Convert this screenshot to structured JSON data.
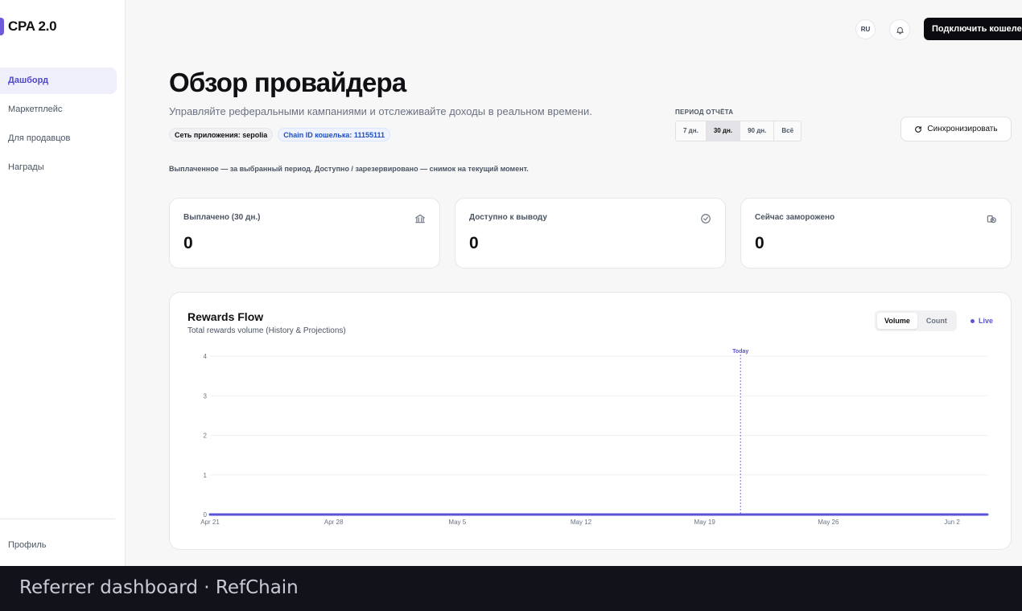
{
  "app": {
    "logo": "CPA 2.0"
  },
  "sidebar": {
    "items": [
      {
        "label": "Дашборд",
        "active": true
      },
      {
        "label": "Маркетплейс",
        "active": false
      },
      {
        "label": "Для продавцов",
        "active": false
      },
      {
        "label": "Награды",
        "active": false
      }
    ],
    "profile": "Профиль"
  },
  "topbar": {
    "lang": "RU",
    "bell_icon": "bell-icon",
    "connect": "Подключить кошелек"
  },
  "header": {
    "title": "Обзор провайдера",
    "subtitle": "Управляйте реферальными кампаниями и отслеживайте доходы в реальном времени.",
    "chips": [
      "Сеть приложения: sepolia",
      "Chain ID кошелька: 11155111"
    ],
    "note": "Выплаченное — за выбранный период. Доступно / зарезервировано — снимок на текущий момент."
  },
  "period": {
    "label": "ПЕРИОД ОТЧЁТА",
    "options": [
      "7 дн.",
      "30 дн.",
      "90 дн.",
      "Всё"
    ],
    "selected": "30 дн."
  },
  "sync": {
    "label": "Синхронизировать",
    "icon": "refresh-icon"
  },
  "stats": [
    {
      "label": "Выплачено (30 дн.)",
      "value": "0",
      "icon": "bank-icon"
    },
    {
      "label": "Доступно к выводу",
      "value": "0",
      "icon": "check-circle-icon"
    },
    {
      "label": "Сейчас заморожено",
      "value": "0",
      "icon": "frozen-coins-icon"
    }
  ],
  "chart": {
    "title": "Rewards Flow",
    "subtitle": "Total rewards volume (History & Projections)",
    "toggle": [
      "Volume",
      "Count"
    ],
    "toggle_selected": "Volume",
    "live": "Live",
    "today_label": "Today",
    "accent": "#5b52d6"
  },
  "chart_data": {
    "type": "line",
    "x": [
      "Apr 21",
      "Apr 28",
      "May 5",
      "May 12",
      "May 19",
      "May 26",
      "Jun 2"
    ],
    "series": [
      {
        "values": [
          0,
          0,
          0,
          0,
          0,
          0,
          0
        ]
      }
    ],
    "yticks": [
      0,
      1,
      2,
      3,
      4
    ],
    "ylim": [
      0,
      4
    ],
    "today_marker": "Today",
    "grid": true
  },
  "footer": {
    "title": "Referrer dashboard · RefChain"
  }
}
